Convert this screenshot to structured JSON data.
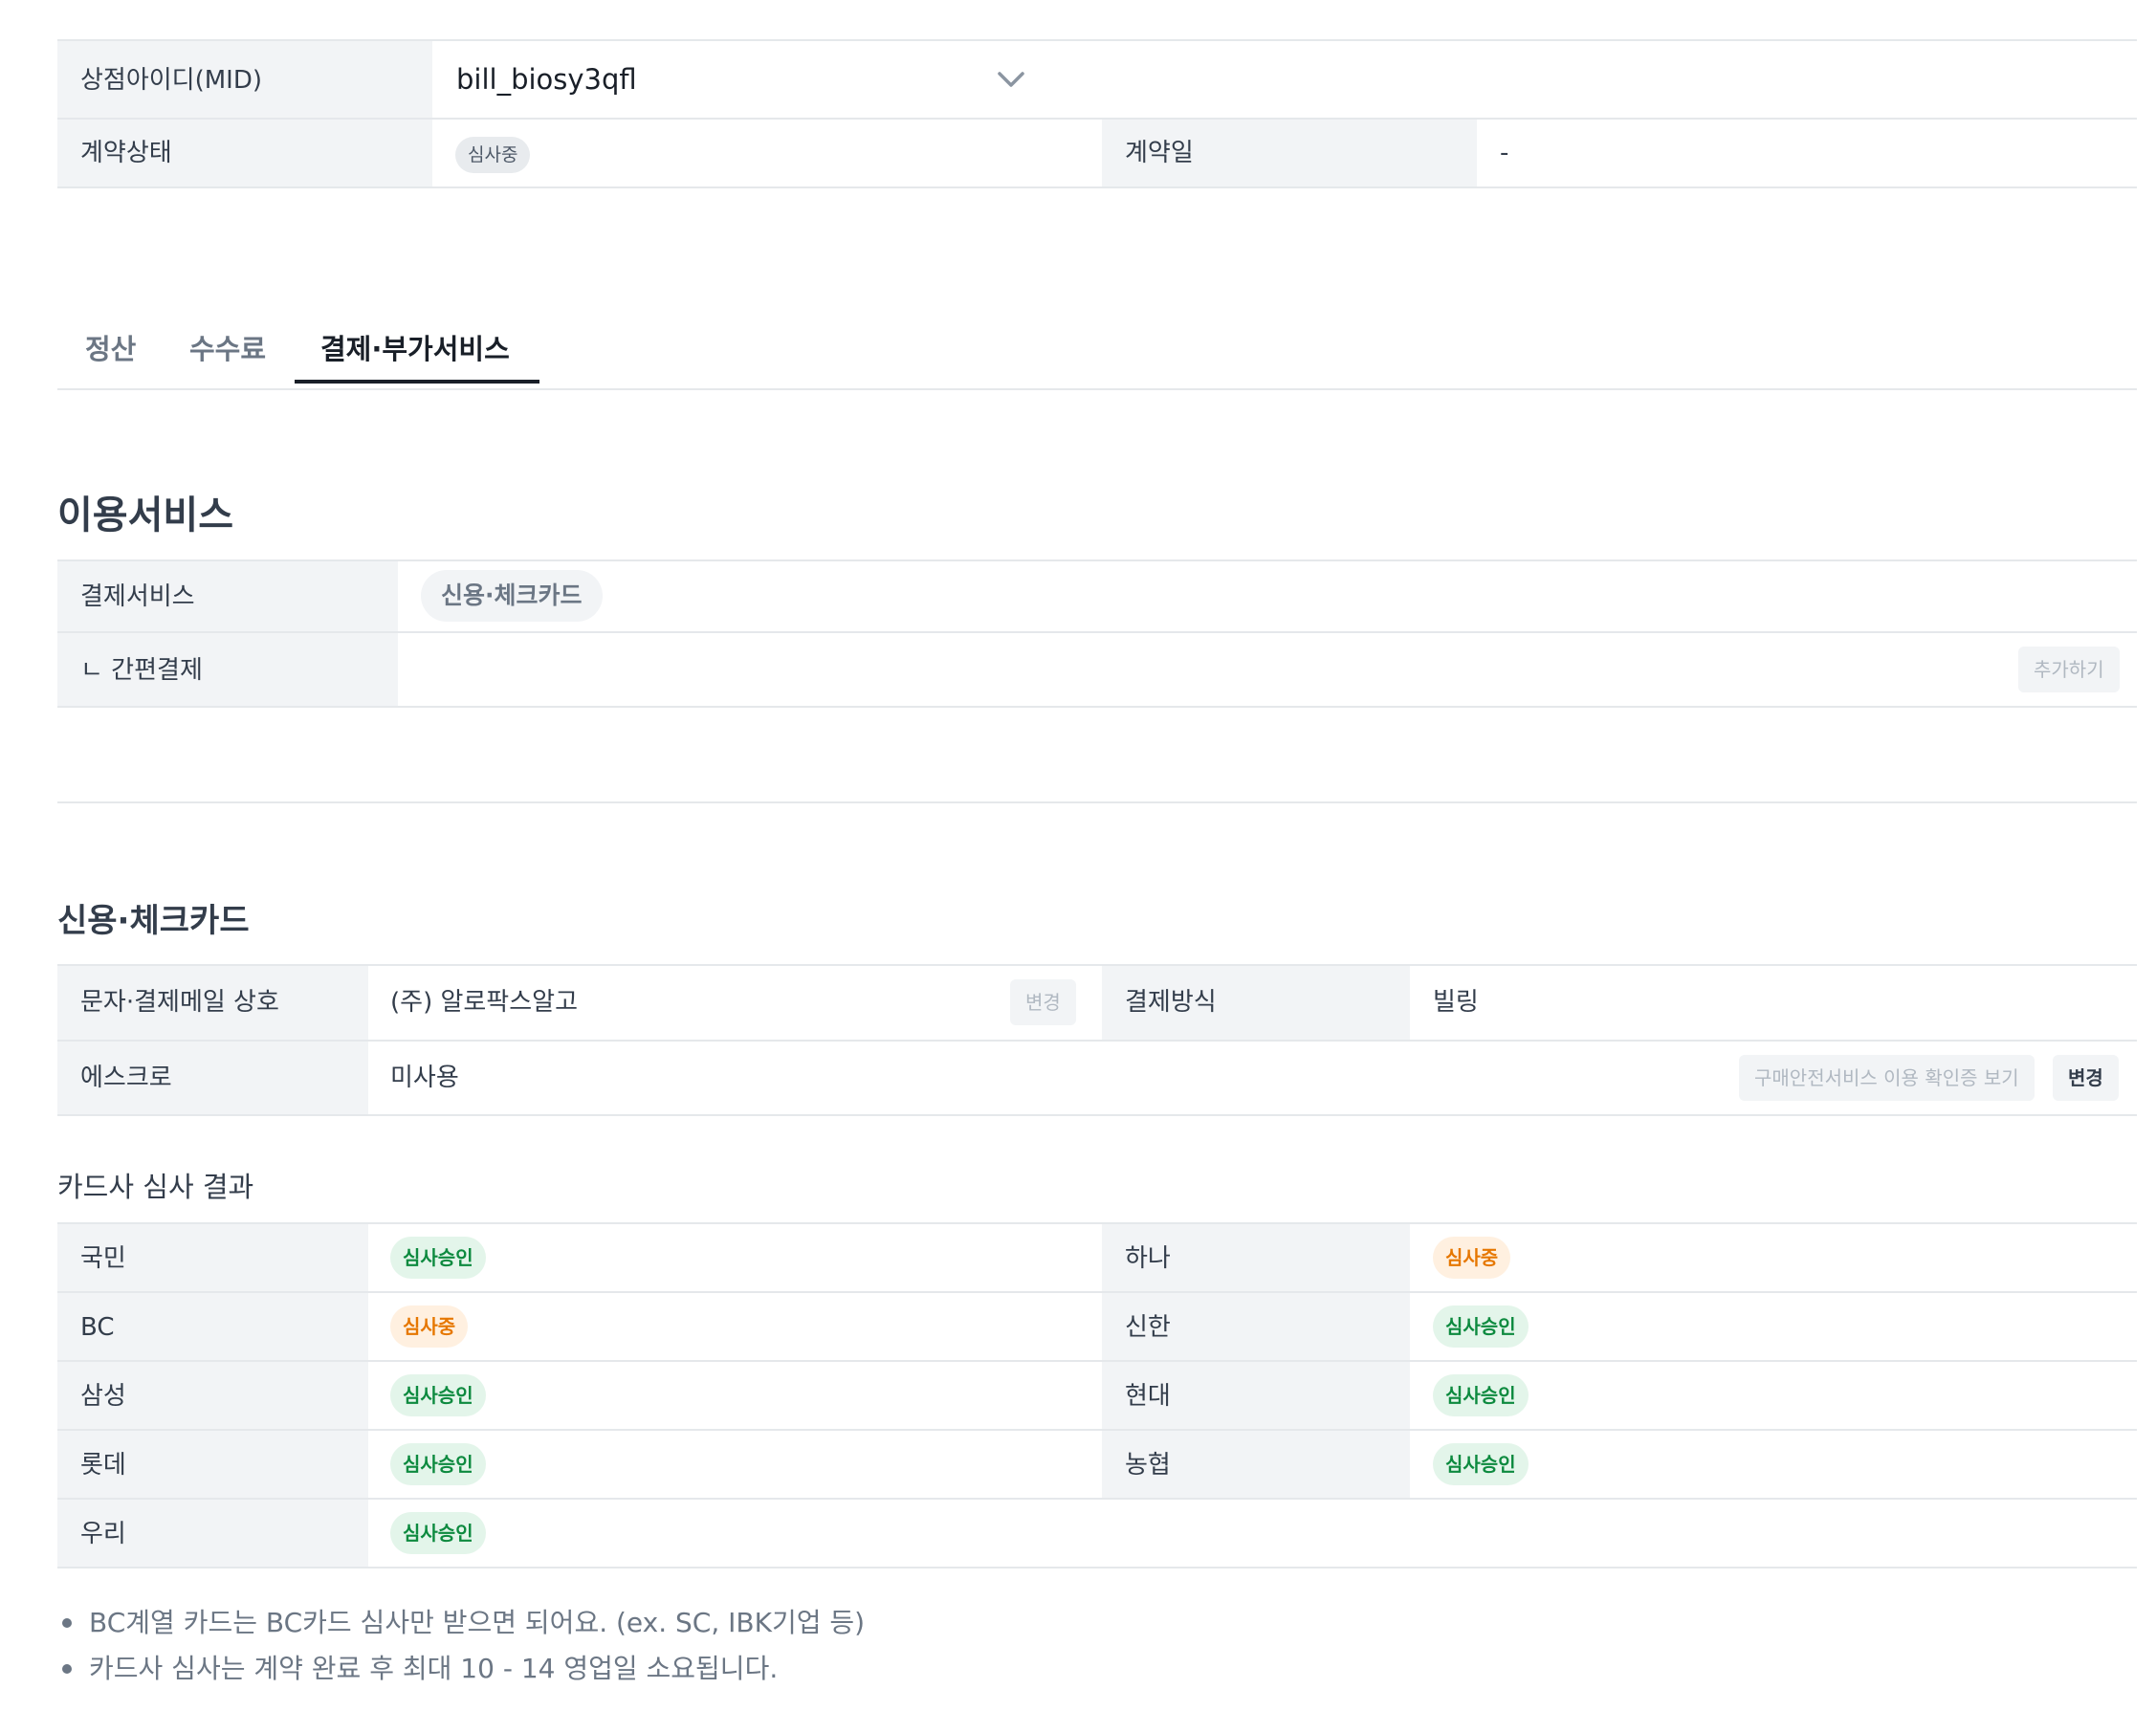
{
  "merchant": {
    "mid_label": "상점아이디(MID)",
    "mid_value": "bill_biosy3qfl",
    "status_label": "계약상태",
    "status_badge": "심사중",
    "contract_date_label": "계약일",
    "contract_date_value": "-"
  },
  "tabs": [
    {
      "label": "정산",
      "active": false
    },
    {
      "label": "수수료",
      "active": false
    },
    {
      "label": "결제·부가서비스",
      "active": true
    }
  ],
  "services": {
    "title": "이용서비스",
    "payment_service_label": "결제서비스",
    "payment_service_chip": "신용·체크카드",
    "simple_pay_label": "ㄴ 간편결제",
    "add_button": "추가하기"
  },
  "card": {
    "title": "신용·체크카드",
    "sms_label": "문자·결제메일 상호",
    "sms_value": "(주) 알로팍스알고",
    "sms_change": "변경",
    "method_label": "결제방식",
    "method_value": "빌링",
    "escrow_label": "에스크로",
    "escrow_value": "미사용",
    "escrow_cert_button": "구매안전서비스 이용 확인증 보기",
    "escrow_change": "변경"
  },
  "review": {
    "title": "카드사 심사 결과",
    "rows": [
      {
        "left_name": "국민",
        "left_status": "심사승인",
        "right_name": "하나",
        "right_status": "심사중"
      },
      {
        "left_name": "BC",
        "left_status": "심사중",
        "right_name": "신한",
        "right_status": "심사승인"
      },
      {
        "left_name": "삼성",
        "left_status": "심사승인",
        "right_name": "현대",
        "right_status": "심사승인"
      },
      {
        "left_name": "롯데",
        "left_status": "심사승인",
        "right_name": "농협",
        "right_status": "심사승인"
      },
      {
        "left_name": "우리",
        "left_status": "심사승인"
      }
    ]
  },
  "notes": [
    "BC계열 카드는 BC카드 심사만 받으면 되어요. (ex. SC, IBK기업 등)",
    "카드사 심사는 계약 완료 후 최대 10 - 14 영업일 소요됩니다."
  ],
  "colors": {
    "approved_bg": "#e3f5ea",
    "approved_text": "#0d8a3f",
    "pending_bg": "#fff0e0",
    "pending_text": "#e67700",
    "header_cell_bg": "#f2f4f6"
  }
}
